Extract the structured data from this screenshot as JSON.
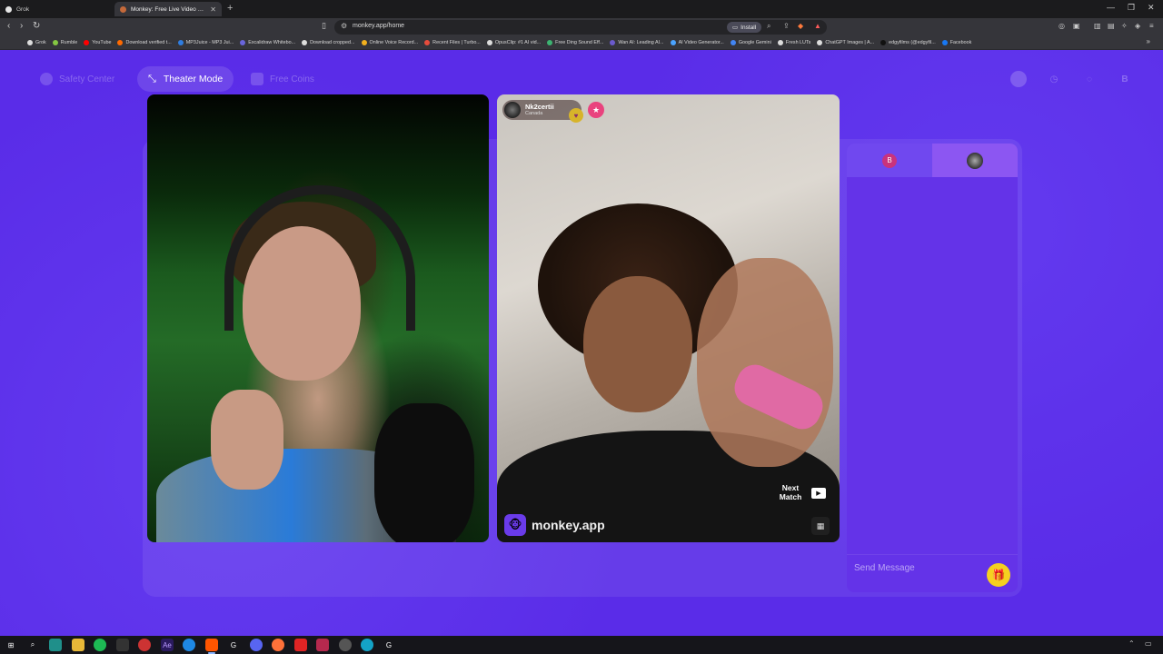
{
  "browser": {
    "tabs": [
      {
        "title": "Grok",
        "active": false
      },
      {
        "title": "Monkey: Free Live Video Chat",
        "active": true
      }
    ],
    "url": "monkey.app/home",
    "install_label": "Install",
    "bookmarks": [
      {
        "label": "Grok",
        "color": "#dddddd"
      },
      {
        "label": "Rumble",
        "color": "#85c742"
      },
      {
        "label": "YouTube",
        "color": "#ff0000"
      },
      {
        "label": "Download verified t...",
        "color": "#ff6a00"
      },
      {
        "label": "MP3Juice - MP3 Jui...",
        "color": "#2f7de1"
      },
      {
        "label": "Excalidraw Whitebo...",
        "color": "#6965db"
      },
      {
        "label": "Download cropped...",
        "color": "#dddddd"
      },
      {
        "label": "Online Voice Record...",
        "color": "#f2b01e"
      },
      {
        "label": "Recent Files | Turbo...",
        "color": "#e74c3c"
      },
      {
        "label": "OpusClip: #1 AI vid...",
        "color": "#dddddd"
      },
      {
        "label": "Free Ding Sound Eff...",
        "color": "#3cb371"
      },
      {
        "label": "Wan AI: Leading AI...",
        "color": "#6a5acd"
      },
      {
        "label": "AI Video Generator...",
        "color": "#4aa3ff"
      },
      {
        "label": "Google Gemini",
        "color": "#4285f4"
      },
      {
        "label": "Fresh LUTs",
        "color": "#dddddd"
      },
      {
        "label": "ChatGPT Images | A...",
        "color": "#dddddd"
      },
      {
        "label": "edgyfilms (@edgyfil...",
        "color": "#111111"
      },
      {
        "label": "Facebook",
        "color": "#1877f2"
      }
    ]
  },
  "header": {
    "safety_label": "Safety Center",
    "theater_label": "Theater Mode",
    "coins_label": "Free Coins",
    "profile_initial": "B"
  },
  "remote_user": {
    "name": "Nk2certii",
    "country": "Canada"
  },
  "video_controls": {
    "next_match_line1": "Next",
    "next_match_line2": "Match",
    "brand": "monkey.app"
  },
  "chat": {
    "self_initial": "B",
    "placeholder": "Send Message"
  },
  "colors": {
    "page_bg": "#5a2ce8",
    "chat_bg": "#6433e8",
    "gift": "#f5d020",
    "heart": "#d7b42a"
  }
}
